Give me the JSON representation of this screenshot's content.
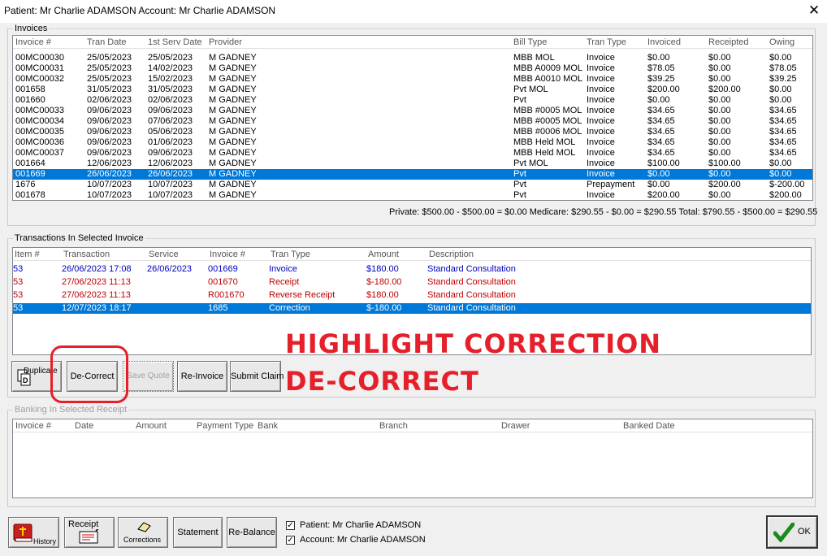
{
  "window": {
    "title": "Patient: Mr Charlie ADAMSON  Account: Mr Charlie ADAMSON",
    "close_glyph": "✕"
  },
  "invoices": {
    "group_label": "Invoices",
    "headers": [
      "Invoice #",
      "Tran Date",
      "1st Serv Date",
      "Provider",
      "Bill Type",
      "Tran Type",
      "Invoiced",
      "Receipted",
      "Owing"
    ],
    "rows": [
      [
        "00MC00030",
        "25/05/2023",
        "25/05/2023",
        "M GADNEY",
        "MBB MOL",
        "Invoice",
        "$0.00",
        "$0.00",
        "$0.00"
      ],
      [
        "00MC00031",
        "25/05/2023",
        "14/02/2023",
        "M GADNEY",
        "MBB A0009 MOL",
        "Invoice",
        "$78.05",
        "$0.00",
        "$78.05"
      ],
      [
        "00MC00032",
        "25/05/2023",
        "15/02/2023",
        "M GADNEY",
        "MBB A0010 MOL",
        "Invoice",
        "$39.25",
        "$0.00",
        "$39.25"
      ],
      [
        "001658",
        "31/05/2023",
        "31/05/2023",
        "M GADNEY",
        "Pvt MOL",
        "Invoice",
        "$200.00",
        "$200.00",
        "$0.00"
      ],
      [
        "001660",
        "02/06/2023",
        "02/06/2023",
        "M GADNEY",
        "Pvt",
        "Invoice",
        "$0.00",
        "$0.00",
        "$0.00"
      ],
      [
        "00MC00033",
        "09/06/2023",
        "09/06/2023",
        "M GADNEY",
        "MBB #0005 MOL",
        "Invoice",
        "$34.65",
        "$0.00",
        "$34.65"
      ],
      [
        "00MC00034",
        "09/06/2023",
        "07/06/2023",
        "M GADNEY",
        "MBB #0005 MOL",
        "Invoice",
        "$34.65",
        "$0.00",
        "$34.65"
      ],
      [
        "00MC00035",
        "09/06/2023",
        "05/06/2023",
        "M GADNEY",
        "MBB #0006 MOL",
        "Invoice",
        "$34.65",
        "$0.00",
        "$34.65"
      ],
      [
        "00MC00036",
        "09/06/2023",
        "01/06/2023",
        "M GADNEY",
        "MBB Held MOL",
        "Invoice",
        "$34.65",
        "$0.00",
        "$34.65"
      ],
      [
        "00MC00037",
        "09/06/2023",
        "09/06/2023",
        "M GADNEY",
        "MBB Held MOL",
        "Invoice",
        "$34.65",
        "$0.00",
        "$34.65"
      ],
      [
        "001664",
        "12/06/2023",
        "12/06/2023",
        "M GADNEY",
        "Pvt MOL",
        "Invoice",
        "$100.00",
        "$100.00",
        "$0.00"
      ],
      [
        "001669",
        "26/06/2023",
        "26/06/2023",
        "M GADNEY",
        "Pvt",
        "Invoice",
        "$0.00",
        "$0.00",
        "$0.00"
      ],
      [
        "1676",
        "10/07/2023",
        "10/07/2023",
        "M GADNEY",
        "Pvt",
        "Prepayment",
        "$0.00",
        "$200.00",
        "$-200.00"
      ],
      [
        "001678",
        "10/07/2023",
        "10/07/2023",
        "M GADNEY",
        "Pvt",
        "Invoice",
        "$200.00",
        "$0.00",
        "$200.00"
      ]
    ],
    "selected_index": 11,
    "totals": "Private: $500.00 - $500.00 = $0.00  Medicare: $290.55 - $0.00 = $290.55  Total: $790.55 - $500.00 = $290.55"
  },
  "transactions": {
    "group_label": "Transactions In Selected Invoice",
    "headers": [
      "Item #",
      "Transaction",
      "Service",
      "Invoice #",
      "Tran Type",
      "Amount",
      "Description"
    ],
    "rows": [
      {
        "cells": [
          "53",
          "26/06/2023 17:08",
          "26/06/2023",
          "001669",
          "Invoice",
          "$180.00",
          "Standard Consultation"
        ],
        "color": "blue"
      },
      {
        "cells": [
          "53",
          "27/06/2023 11:13",
          "",
          "001670",
          "Receipt",
          "$-180.00",
          "Standard Consultation"
        ],
        "color": "red"
      },
      {
        "cells": [
          "53",
          "27/06/2023 11:13",
          "",
          "R001670",
          "Reverse Receipt",
          "$180.00",
          "Standard Consultation"
        ],
        "color": "red"
      },
      {
        "cells": [
          "53",
          "12/07/2023 18:17",
          "",
          "1685",
          "Correction",
          "$-180.00",
          "Standard Consultation"
        ],
        "color": "selected"
      }
    ],
    "buttons": {
      "duplicate": "Duplicate",
      "de_correct": "De-Correct",
      "save_quote": "Save Quote",
      "re_invoice": "Re-Invoice",
      "submit_claim": "Submit Claim"
    }
  },
  "annotation": {
    "line1": "HIGHLIGHT CORRECTION",
    "line2": "DE-CORRECT",
    "color": "#e6202a"
  },
  "banking": {
    "group_label": "Banking In Selected Receipt",
    "headers": [
      "Invoice #",
      "Date",
      "Amount",
      "Payment Type",
      "Bank",
      "Branch",
      "Drawer",
      "Banked Date"
    ]
  },
  "footer": {
    "history": "History",
    "receipt": "Receipt",
    "corrections": "Corrections",
    "statement": "Statement",
    "rebalance": "Re-Balance",
    "patient_check": "Patient: Mr Charlie ADAMSON",
    "account_check": "Account: Mr Charlie ADAMSON",
    "ok": "OK"
  },
  "colors": {
    "selection": "#0078d7",
    "invoice_text": "#0000c0",
    "receipt_text": "#c00000"
  }
}
